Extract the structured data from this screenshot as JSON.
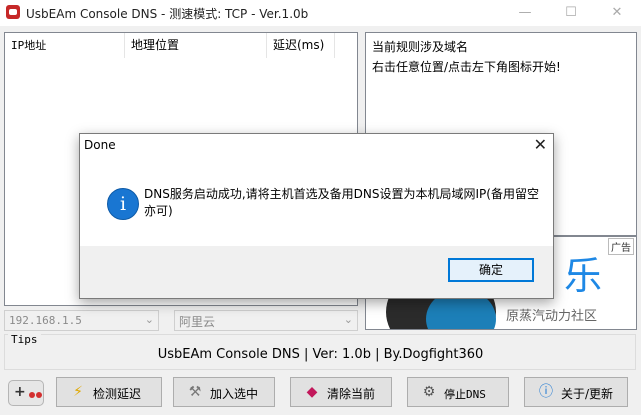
{
  "window": {
    "title": "UsbEAm Console DNS - 测速模式: TCP - Ver.1.0b",
    "minimize": "—",
    "maximize": "☐",
    "close": "✕"
  },
  "list": {
    "columns": [
      "IP地址",
      "地理位置",
      "延迟(ms)"
    ]
  },
  "rules_panel": {
    "heading": "当前规则涉及域名",
    "hint": "右击任意位置/点击左下角图标开始!"
  },
  "ad": {
    "tag": "广告",
    "big_text": "乐",
    "sub_text": "原蒸汽动力社区"
  },
  "ip_select": {
    "value": "192.168.1.5"
  },
  "provider_select": {
    "value": "阿里云"
  },
  "tips": {
    "label": "Tips",
    "text": "UsbEAm Console DNS | Ver: 1.0b | By.Dogfight360"
  },
  "toolbar": {
    "detect_latency": "检测延迟",
    "add_selected": "加入选中",
    "clear_current": "清除当前",
    "stop_dns": "停止DNS",
    "about_update": "关于/更新"
  },
  "dialog": {
    "title": "Done",
    "message": "DNS服务启动成功,请将主机首选及备用DNS设置为本机局域网IP(备用留空亦可)",
    "ok": "确定"
  },
  "colors": {
    "accent": "#0078d7",
    "info_icon": "#1976d2",
    "app_icon": "#c62828"
  }
}
